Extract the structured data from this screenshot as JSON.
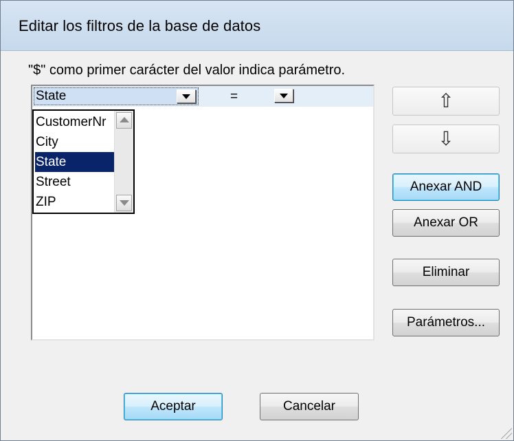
{
  "dialog": {
    "title": "Editar los filtros de la base de datos",
    "hint": "\"$\" como primer carácter del valor indica parámetro."
  },
  "filter_row": {
    "field_value": "State",
    "operator_value": "="
  },
  "field_dropdown": {
    "options": [
      "CustomerNr",
      "City",
      "State",
      "Street",
      "ZIP"
    ],
    "selected": "State"
  },
  "side_buttons": {
    "move_up_icon": "arrow-up-icon",
    "move_down_icon": "arrow-down-icon",
    "append_and": "Anexar AND",
    "append_or": "Anexar OR",
    "delete": "Eliminar",
    "parameters": "Parámetros..."
  },
  "footer": {
    "ok": "Aceptar",
    "cancel": "Cancelar"
  },
  "colors": {
    "titlebar": "#c6d9ec",
    "selection": "#0a246a",
    "default_button": "#bee6fd"
  }
}
